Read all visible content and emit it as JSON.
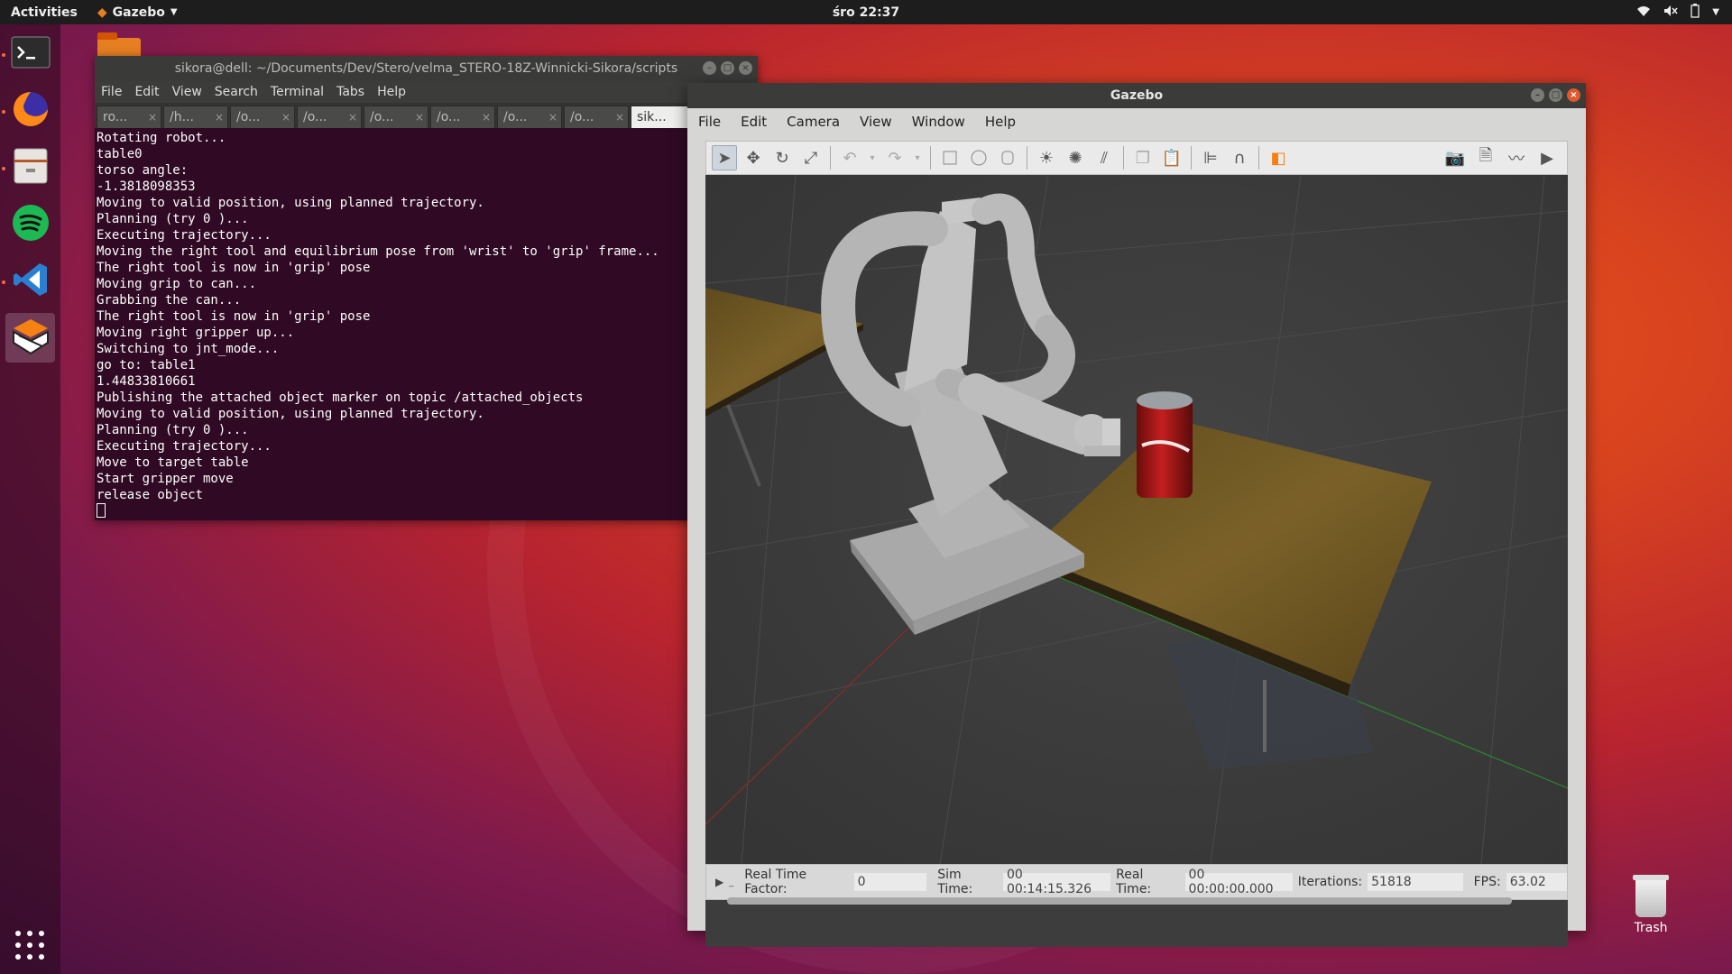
{
  "topbar": {
    "activities": "Activities",
    "app_name": "Gazebo",
    "clock": "śro 22:37"
  },
  "terminal": {
    "title": "sikora@dell: ~/Documents/Dev/Stero/velma_STERO-18Z-Winnicki-Sikora/scripts",
    "menu": [
      "File",
      "Edit",
      "View",
      "Search",
      "Terminal",
      "Tabs",
      "Help"
    ],
    "tabs": [
      "ro...",
      "/h...",
      "/o...",
      "/o...",
      "/o...",
      "/o...",
      "/o...",
      "/o...",
      "sik..."
    ],
    "lines": [
      "Rotating robot...",
      "table0",
      "torso angle:",
      "-1.3818098353",
      "Moving to valid position, using planned trajectory.",
      "Planning (try 0 )...",
      "Executing trajectory...",
      "Moving the right tool and equilibrium pose from 'wrist' to 'grip' frame...",
      "The right tool is now in 'grip' pose",
      "Moving grip to can...",
      "Grabbing the can...",
      "The right tool is now in 'grip' pose",
      "Moving right gripper up...",
      "Switching to jnt_mode...",
      "go to: table1",
      "1.44833810661",
      "Publishing the attached object marker on topic /attached_objects",
      "Moving to valid position, using planned trajectory.",
      "Planning (try 0 )...",
      "Executing trajectory...",
      "Move to target table",
      "Start gripper move",
      "release object"
    ]
  },
  "gazebo": {
    "title": "Gazebo",
    "menu": [
      "File",
      "Edit",
      "Camera",
      "View",
      "Window",
      "Help"
    ],
    "status": {
      "rtf_label": "Real Time Factor:",
      "rtf_value": "0",
      "sim_label": "Sim Time:",
      "sim_value": "00 00:14:15.326",
      "real_label": "Real Time:",
      "real_value": "00 00:00:00.000",
      "iter_label": "Iterations:",
      "iter_value": "51818",
      "fps_label": "FPS:",
      "fps_value": "63.02"
    }
  },
  "desktop": {
    "trash_label": "Trash"
  },
  "colors": {
    "accent": "#e95420",
    "terminal_bg": "#300a24",
    "viewport_bg": "#3d3d3d"
  }
}
